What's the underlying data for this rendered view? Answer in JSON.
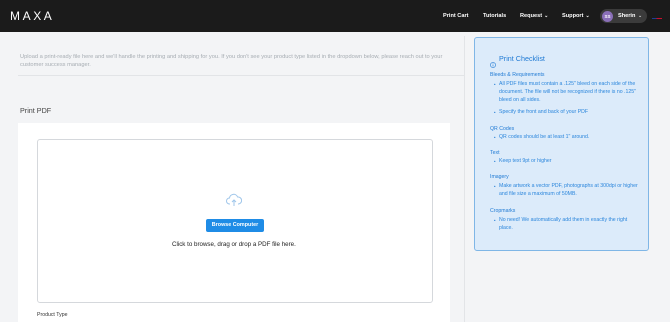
{
  "header": {
    "logo": "MAXA",
    "nav": [
      {
        "label": "Print Cart"
      },
      {
        "label": "Tutorials"
      },
      {
        "label": "Request"
      },
      {
        "label": "Support"
      }
    ],
    "user": {
      "initials": "SS",
      "name": "Sherin"
    },
    "flag_icon": "us-flag-icon"
  },
  "main": {
    "intro": "Upload a print-ready file here and we'll handle the printing and shipping for you. If you don't see your product type listed in the dropdown below, please reach out to your customer success manager.",
    "section_title": "Print PDF",
    "dropzone": {
      "icon": "cloud-upload-icon",
      "button_label": "Browse Computer",
      "hint": "Click to browse, drag or drop a PDF file here."
    },
    "product_type_label": "Product Type"
  },
  "checklist": {
    "title": "Print Checklist",
    "icon": "info-icon",
    "sections": [
      {
        "heading": "Bleeds & Requirements",
        "items": [
          "All PDF files must contain a .125\" bleed on each side of the document. The file will not be recognized if there is no .125\" bleed on all sides.",
          "Specify the front and back of your PDF"
        ]
      },
      {
        "heading": "QR Codes",
        "items": [
          "QR codes should be at least 1\" around."
        ]
      },
      {
        "heading": "Text",
        "items": [
          "Keep text 9pt or higher"
        ]
      },
      {
        "heading": "Imagery",
        "items": [
          "Make artwork a vector PDF, photographs at 300dpi or higher and file size a maximum of 50MB."
        ]
      },
      {
        "heading": "Cropmarks",
        "items": [
          "No need! We automatically add them in exactly the right place."
        ]
      }
    ]
  },
  "colors": {
    "topbar": "#1b1b1b",
    "accent": "#1f8ce6",
    "checklist_bg": "#dcebfa",
    "checklist_text": "#1f7ad4"
  }
}
